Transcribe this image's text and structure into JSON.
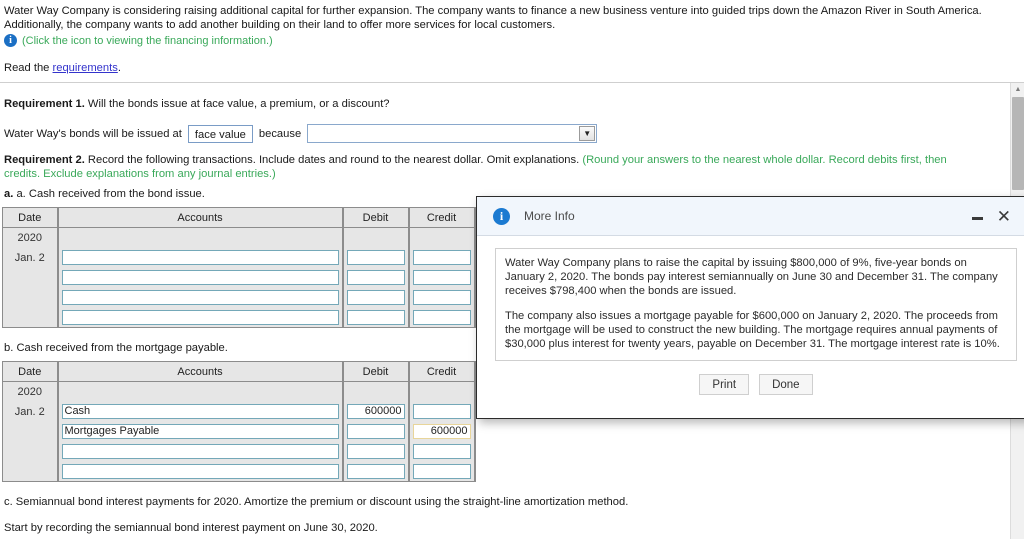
{
  "intro": {
    "paragraph": "Water Way Company is considering raising additional capital for further expansion. The company wants to finance a new business venture into guided trips down the Amazon River in South America. Additionally, the company wants to add another building on their land to offer more services for local customers.",
    "icon_note": "(Click the icon to viewing the financing information.)",
    "read_prefix": "Read the ",
    "read_link": "requirements",
    "read_suffix": "."
  },
  "requirement1": {
    "label": "Requirement 1.",
    "text": " Will the bonds issue at face value, a premium, or a discount?",
    "sentence_prefix": "Water Way's bonds will be issued at",
    "issue_value": "face value",
    "sentence_mid": "because",
    "reason_value": "",
    "dropdown_arrow": "▼"
  },
  "requirement2": {
    "label": "Requirement 2.",
    "text": " Record the following transactions. Include dates and round to the nearest dollar. Omit explanations. ",
    "green_text": "(Round your answers to the nearest whole dollar. Record debits first, then credits. Exclude explanations from any journal entries.)"
  },
  "parts": {
    "a": "a. Cash received from the bond issue.",
    "b": "b. Cash received from the mortgage payable.",
    "c": "c. Semiannual bond interest payments for 2020. Amortize the premium or discount using the straight-line amortization method.",
    "c_followup": "Start by recording the semiannual bond interest payment on June 30, 2020."
  },
  "table_headers": [
    "Date",
    "Accounts",
    "Debit",
    "Credit"
  ],
  "table_a": {
    "year": "2020",
    "day": "Jan. 2",
    "rows": [
      {
        "account": "",
        "debit": "",
        "credit": "",
        "credit_focus": false
      },
      {
        "account": "",
        "debit": "",
        "credit": "",
        "credit_focus": false
      },
      {
        "account": "",
        "debit": "",
        "credit": "",
        "credit_focus": false
      },
      {
        "account": "",
        "debit": "",
        "credit": "",
        "credit_focus": false
      }
    ]
  },
  "table_b": {
    "year": "2020",
    "day": "Jan. 2",
    "rows": [
      {
        "account": "Cash",
        "debit": "600000",
        "credit": "",
        "credit_focus": false
      },
      {
        "account": "Mortgages Payable",
        "debit": "",
        "credit": "600000",
        "credit_focus": true
      },
      {
        "account": "",
        "debit": "",
        "credit": "",
        "credit_focus": false
      },
      {
        "account": "",
        "debit": "",
        "credit": "",
        "credit_focus": false
      }
    ]
  },
  "modal": {
    "icon": "info-icon",
    "title": "More Info",
    "minimize_label": "minimize",
    "close_label": "✕",
    "paragraph1": "Water Way Company plans to raise the capital by issuing $800,000 of 9%, five-year bonds on January 2, 2020. The bonds pay interest semiannually on June 30 and December 31. The company receives $798,400 when the bonds are issued.",
    "paragraph2": "The company also issues a mortgage payable for $600,000 on January 2, 2020. The proceeds from the mortgage will be used to construct the new building. The mortgage requires annual payments of $30,000 plus interest for twenty years, payable on December 31. The mortgage interest rate is 10%.",
    "print_label": "Print",
    "done_label": "Done"
  },
  "scrollbar": {
    "up_arrow": "▲"
  },
  "colors": {
    "accent_blue": "#1b7ad1",
    "green_note": "#3aa95a",
    "link": "#3333cc",
    "input_border": "#74a8b8",
    "focus_border": "#e8d59a"
  }
}
